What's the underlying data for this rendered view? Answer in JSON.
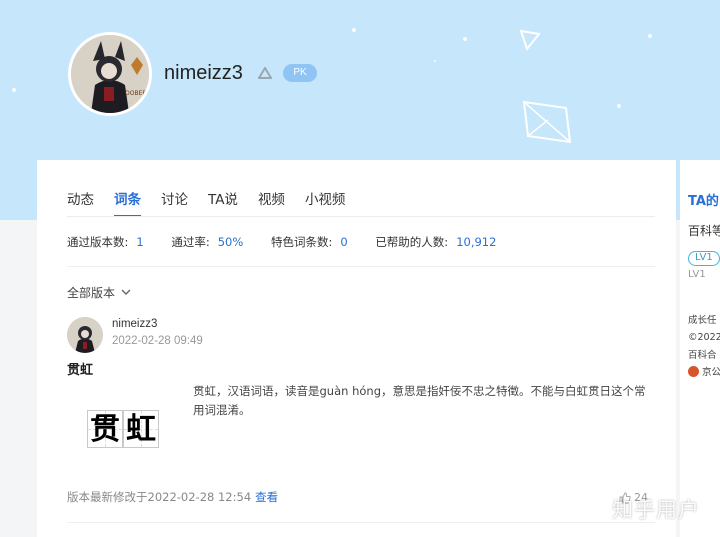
{
  "profile": {
    "username": "nimeizz3",
    "pk_badge": "PK"
  },
  "tabs": [
    {
      "label": "动态"
    },
    {
      "label": "词条"
    },
    {
      "label": "讨论"
    },
    {
      "label": "TA说"
    },
    {
      "label": "视频"
    },
    {
      "label": "小视频"
    }
  ],
  "stats": {
    "versions_label": "通过版本数:",
    "versions_value": "1",
    "rate_label": "通过率:",
    "rate_value": "50%",
    "featured_label": "特色词条数:",
    "featured_value": "0",
    "helped_label": "已帮助的人数:",
    "helped_value": "10,912"
  },
  "filter": {
    "label": "全部版本"
  },
  "entry": {
    "user": "nimeizz3",
    "time": "2022-02-28 09:49",
    "title": "贯虹",
    "image_chars": [
      "贯",
      "虹"
    ],
    "text": "贯虹，汉语词语，读音是guàn hóng，意思是指奸佞不忠之特徵。不能与白虹贯日这个常用词混淆。",
    "modified_prefix": "版本最新修改于",
    "modified_time": "2022-02-28 12:54",
    "view_link": "查看",
    "like_count": "24"
  },
  "sidebar": {
    "title": "TA的",
    "subtitle": "百科等",
    "level_badge": "LV1",
    "level_text": "LV1",
    "growth": "成长任",
    "copyright": "©2022",
    "copyright2": "百科合",
    "police": "京公"
  },
  "watermark": "知乎用户",
  "colors": {
    "banner": "#c6e6fb",
    "accent": "#2a6fd6",
    "pk_badge": "#8fc4f4"
  }
}
